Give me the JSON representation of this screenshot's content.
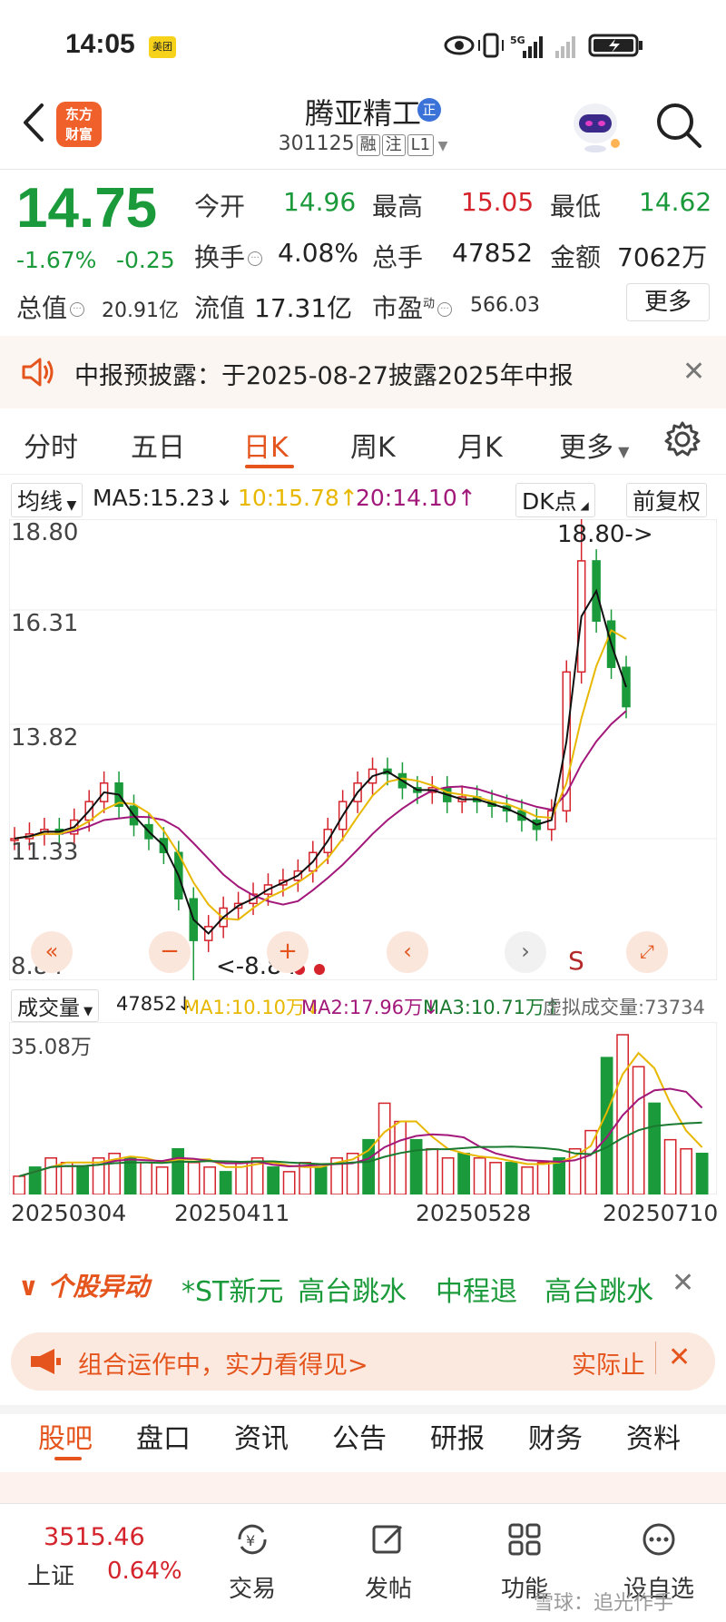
{
  "status_bar": {
    "time": "14:05",
    "meituan_label": "美团",
    "network": "5G"
  },
  "header": {
    "logo_line1": "东方",
    "logo_line2": "财富",
    "stock_name": "腾亚精工",
    "badge": "正",
    "stock_code": "301125",
    "tags": [
      "融",
      "注",
      "L1"
    ]
  },
  "quote": {
    "price": "14.75",
    "change_pct": "-1.67%",
    "change_abs": "-0.25",
    "open_label": "今开",
    "open_value": "14.96",
    "high_label": "最高",
    "high_value": "15.05",
    "low_label": "最低",
    "low_value": "14.62",
    "turnover_label": "换手",
    "turnover_value": "4.08%",
    "volume_label": "总手",
    "volume_value": "47852",
    "amount_label": "金额",
    "amount_value": "7062万",
    "mktcap_label": "总值",
    "mktcap_value": "20.91亿",
    "float_label": "流值",
    "float_value": "17.31亿",
    "pe_label": "市盈",
    "pe_sup": "动",
    "pe_value": "566.03",
    "more_label": "更多"
  },
  "notice": {
    "text": "中报预披露：于2025-08-27披露2025年中报"
  },
  "period_tabs": [
    "分时",
    "五日",
    "日K",
    "周K",
    "月K",
    "更多"
  ],
  "ma_bar": {
    "selector": "均线",
    "ma5": "MA5:15.23↓",
    "ma10": "10:15.78↑",
    "ma20": "20:14.10↑",
    "dk": "DK点",
    "fq": "前复权"
  },
  "price_axis": [
    "18.80",
    "16.31",
    "13.82",
    "11.33",
    "8.84"
  ],
  "annotations": {
    "high": "18.80->",
    "low": "<-8.84",
    "s_marker": "S"
  },
  "vol_bar": {
    "selector": "成交量",
    "vol": "47852↓",
    "ma1": "MA1:10.10万↓",
    "ma2": "MA2:17.96万↓",
    "ma3": "MA3:10.71万↑",
    "virtual": "虚拟成交量:73734"
  },
  "vol_axis": "35.08万",
  "dates": [
    "20250304",
    "20250411",
    "20250528",
    "20250710"
  ],
  "hot": {
    "title": "个股异动",
    "items": [
      "*ST新元",
      "高台跳水",
      "中程退",
      "高台跳水"
    ]
  },
  "promo": {
    "text": "组合运作中，实力看得见>",
    "right": "实际止"
  },
  "bottom_tabs": [
    "股吧",
    "盘口",
    "资讯",
    "公告",
    "研报",
    "财务",
    "资料"
  ],
  "bottom_nav": {
    "index_value": "3515.46",
    "index_name": "上证",
    "index_change": "0.64%",
    "items": [
      "交易",
      "发帖",
      "功能",
      "设自选"
    ]
  },
  "watermark": "雪球：追光作手",
  "colors": {
    "up": "#d4232b",
    "down": "#1a9a3a",
    "accent": "#e4541c",
    "ma5": "#111111",
    "ma10": "#e8b800",
    "ma20": "#a2187a"
  },
  "chart_data": {
    "type": "candlestick",
    "ylim": [
      8.84,
      18.8
    ],
    "high": 18.8,
    "low": 8.84,
    "close_path": [
      11.9,
      12.0,
      12.1,
      12.0,
      12.3,
      12.7,
      13.1,
      12.6,
      12.2,
      11.9,
      11.6,
      10.6,
      9.7,
      10.0,
      10.4,
      10.5,
      10.7,
      10.9,
      11.0,
      11.2,
      11.6,
      12.1,
      12.7,
      13.1,
      13.4,
      13.3,
      13.0,
      12.9,
      13.0,
      12.7,
      12.8,
      12.7,
      12.6,
      12.5,
      12.3,
      12.1,
      12.5,
      15.5,
      17.9,
      16.6,
      15.6,
      14.75
    ]
  },
  "volume_data": {
    "max_label": "35.08万",
    "values": [
      4,
      6,
      8,
      7,
      6,
      8,
      9,
      8,
      7,
      6,
      10,
      7,
      6,
      5,
      7,
      8,
      6,
      5,
      7,
      6,
      8,
      9,
      12,
      20,
      16,
      12,
      10,
      8,
      9,
      8,
      7,
      7,
      6,
      7,
      8,
      10,
      14,
      30,
      35,
      28,
      20,
      12,
      10,
      9
    ]
  }
}
